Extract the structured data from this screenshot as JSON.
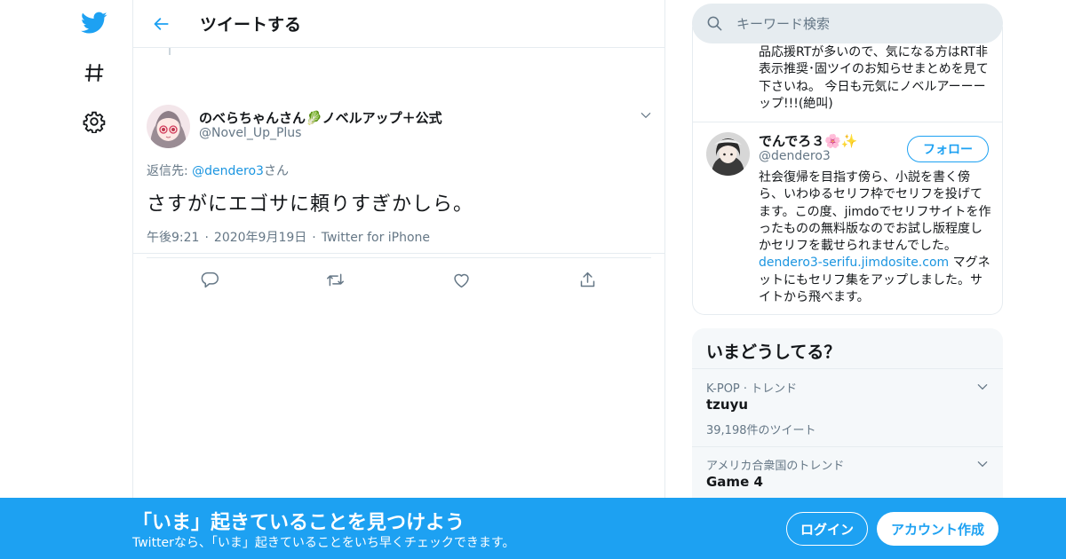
{
  "colors": {
    "brand": "#1da1f2",
    "link": "#1b95e0",
    "muted": "#657786"
  },
  "nav": {
    "logo_icon": "twitter-bird-icon",
    "explore_icon": "hashtag-icon",
    "settings_icon": "gear-icon"
  },
  "header": {
    "title": "ツイートする",
    "back_icon": "arrow-left-icon"
  },
  "tweet": {
    "author_name": "のべらちゃんさん🥬ノベルアップ＋公式",
    "author_handle": "@Novel_Up_Plus",
    "reply_prefix": "返信先: ",
    "reply_mention": "@dendero3",
    "reply_suffix": "さん",
    "text": "さすがにエゴサに頼りすぎかしら。",
    "time": "午後9:21",
    "separator": "·",
    "date": "2020年9月19日",
    "source": "Twitter for iPhone",
    "actions": [
      "reply-icon",
      "retweet-icon",
      "like-icon",
      "share-icon"
    ]
  },
  "search": {
    "placeholder": "キーワード検索"
  },
  "profile_card": {
    "prev_bio": "品応援RTが多いので、気になる方はRT非表示推奨･固ツイのお知らせまとめを見て下さいね。 今日も元気にノベルアーーーップ!!!(絶叫)",
    "name": "でんでろ３🌸✨",
    "handle": "@dendero3",
    "follow_label": "フォロー",
    "bio_text": "社会復帰を目指す傍ら、小説を書く傍ら、いわゆるセリフ枠でセリフを投げてます。この度、jimdoでセリフサイトを作ったものの無料版なのでお試し版程度しかセリフを載せられませんでした。 ",
    "bio_link": "dendero3-serifu.jimdosite.com",
    "bio_tail": " マグネットにもセリフ集をアップしました。サイトから飛べます。"
  },
  "trends": {
    "title": "いまどうしてる？",
    "items": [
      {
        "meta": "K-POP · トレンド",
        "name": "tzuyu",
        "count": "39,198件のツイート"
      },
      {
        "meta": "アメリカ合衆国のトレンド",
        "name": "Game 4",
        "count": ""
      }
    ]
  },
  "banner": {
    "title": "「いま」起きていることを見つけよう",
    "subtitle": "Twitterなら、「いま」起きていることをいち早くチェックできます。",
    "login_label": "ログイン",
    "signup_label": "アカウント作成"
  }
}
